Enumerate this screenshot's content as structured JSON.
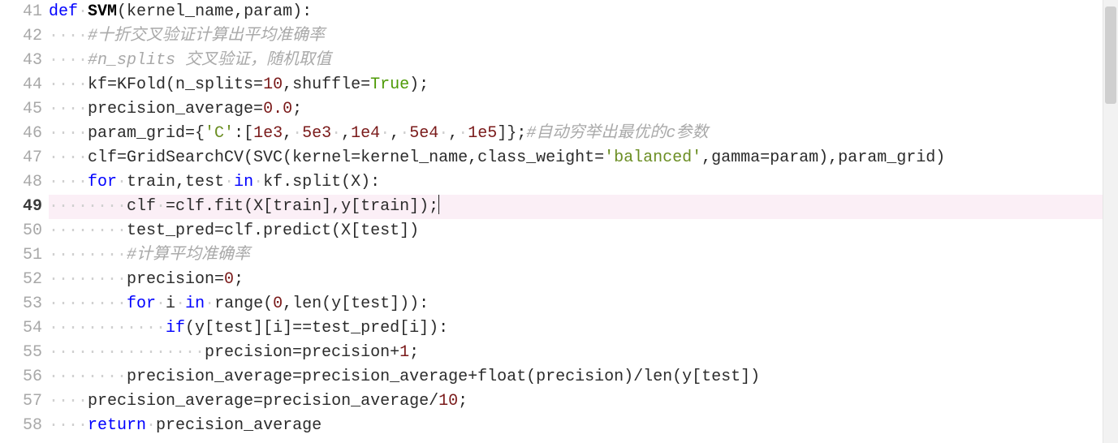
{
  "editor": {
    "currentLine": 49,
    "lines": [
      {
        "num": "41",
        "tokens": [
          {
            "cls": "kw",
            "t": "def"
          },
          {
            "cls": "ws",
            "t": "·"
          },
          {
            "cls": "fn",
            "t": "SVM"
          },
          {
            "cls": "tk",
            "t": "(kernel_name,param):"
          }
        ]
      },
      {
        "num": "42",
        "tokens": [
          {
            "cls": "ws",
            "t": "····"
          },
          {
            "cls": "cm",
            "t": "#十折交叉验证计算出平均准确率"
          }
        ]
      },
      {
        "num": "43",
        "tokens": [
          {
            "cls": "ws",
            "t": "····"
          },
          {
            "cls": "cm",
            "t": "#n_splits 交叉验证，随机取值"
          }
        ]
      },
      {
        "num": "44",
        "tokens": [
          {
            "cls": "ws",
            "t": "····"
          },
          {
            "cls": "tk",
            "t": "kf=KFold(n_splits="
          },
          {
            "cls": "num",
            "t": "10"
          },
          {
            "cls": "tk",
            "t": ",shuffle="
          },
          {
            "cls": "bool",
            "t": "True"
          },
          {
            "cls": "tk",
            "t": ");"
          }
        ]
      },
      {
        "num": "45",
        "tokens": [
          {
            "cls": "ws",
            "t": "····"
          },
          {
            "cls": "tk",
            "t": "precision_average="
          },
          {
            "cls": "num",
            "t": "0.0"
          },
          {
            "cls": "tk",
            "t": ";"
          }
        ]
      },
      {
        "num": "46",
        "tokens": [
          {
            "cls": "ws",
            "t": "····"
          },
          {
            "cls": "tk",
            "t": "param_grid={"
          },
          {
            "cls": "str",
            "t": "'C'"
          },
          {
            "cls": "tk",
            "t": ":["
          },
          {
            "cls": "num",
            "t": "1e3"
          },
          {
            "cls": "tk",
            "t": ","
          },
          {
            "cls": "ws",
            "t": "·"
          },
          {
            "cls": "num",
            "t": "5e3"
          },
          {
            "cls": "ws",
            "t": "·"
          },
          {
            "cls": "tk",
            "t": ","
          },
          {
            "cls": "num",
            "t": "1e4"
          },
          {
            "cls": "ws",
            "t": "·"
          },
          {
            "cls": "tk",
            "t": ","
          },
          {
            "cls": "ws",
            "t": "·"
          },
          {
            "cls": "num",
            "t": "5e4"
          },
          {
            "cls": "ws",
            "t": "·"
          },
          {
            "cls": "tk",
            "t": ","
          },
          {
            "cls": "ws",
            "t": "·"
          },
          {
            "cls": "num",
            "t": "1e5"
          },
          {
            "cls": "tk",
            "t": "]};"
          },
          {
            "cls": "cm",
            "t": "#自动穷举出最优的c参数"
          }
        ]
      },
      {
        "num": "47",
        "tokens": [
          {
            "cls": "ws",
            "t": "····"
          },
          {
            "cls": "tk",
            "t": "clf=GridSearchCV(SVC(kernel=kernel_name,class_weight="
          },
          {
            "cls": "str",
            "t": "'balanced'"
          },
          {
            "cls": "tk",
            "t": ",gamma=param),param_grid)"
          }
        ]
      },
      {
        "num": "48",
        "tokens": [
          {
            "cls": "ws",
            "t": "····"
          },
          {
            "cls": "kw",
            "t": "for"
          },
          {
            "cls": "ws",
            "t": "·"
          },
          {
            "cls": "tk",
            "t": "train,test"
          },
          {
            "cls": "ws",
            "t": "·"
          },
          {
            "cls": "kw",
            "t": "in"
          },
          {
            "cls": "ws",
            "t": "·"
          },
          {
            "cls": "tk",
            "t": "kf.split(X):"
          }
        ]
      },
      {
        "num": "49",
        "tokens": [
          {
            "cls": "ws",
            "t": "········"
          },
          {
            "cls": "tk",
            "t": "clf"
          },
          {
            "cls": "ws",
            "t": "·"
          },
          {
            "cls": "tk",
            "t": "=clf.fit(X[train],y[train]);"
          },
          {
            "cls": "cursor",
            "t": ""
          }
        ]
      },
      {
        "num": "50",
        "tokens": [
          {
            "cls": "ws",
            "t": "········"
          },
          {
            "cls": "tk",
            "t": "test_pred=clf.predict(X[test])"
          }
        ]
      },
      {
        "num": "51",
        "tokens": [
          {
            "cls": "ws",
            "t": "········"
          },
          {
            "cls": "cm",
            "t": "#计算平均准确率"
          }
        ]
      },
      {
        "num": "52",
        "tokens": [
          {
            "cls": "ws",
            "t": "········"
          },
          {
            "cls": "tk",
            "t": "precision="
          },
          {
            "cls": "num",
            "t": "0"
          },
          {
            "cls": "tk",
            "t": ";"
          }
        ]
      },
      {
        "num": "53",
        "tokens": [
          {
            "cls": "ws",
            "t": "········"
          },
          {
            "cls": "kw",
            "t": "for"
          },
          {
            "cls": "ws",
            "t": "·"
          },
          {
            "cls": "tk",
            "t": "i"
          },
          {
            "cls": "ws",
            "t": "·"
          },
          {
            "cls": "kw",
            "t": "in"
          },
          {
            "cls": "ws",
            "t": "·"
          },
          {
            "cls": "tk",
            "t": "range("
          },
          {
            "cls": "num",
            "t": "0"
          },
          {
            "cls": "tk",
            "t": ",len(y[test])):"
          }
        ]
      },
      {
        "num": "54",
        "tokens": [
          {
            "cls": "ws",
            "t": "············"
          },
          {
            "cls": "kw",
            "t": "if"
          },
          {
            "cls": "tk",
            "t": "(y[test][i]==test_pred[i]):"
          }
        ]
      },
      {
        "num": "55",
        "tokens": [
          {
            "cls": "ws",
            "t": "················"
          },
          {
            "cls": "tk",
            "t": "precision=precision+"
          },
          {
            "cls": "num",
            "t": "1"
          },
          {
            "cls": "tk",
            "t": ";"
          }
        ]
      },
      {
        "num": "56",
        "tokens": [
          {
            "cls": "ws",
            "t": "········"
          },
          {
            "cls": "tk",
            "t": "precision_average=precision_average+float(precision)/len(y[test])"
          }
        ]
      },
      {
        "num": "57",
        "tokens": [
          {
            "cls": "ws",
            "t": "····"
          },
          {
            "cls": "tk",
            "t": "precision_average=precision_average/"
          },
          {
            "cls": "num",
            "t": "10"
          },
          {
            "cls": "tk",
            "t": ";"
          }
        ]
      },
      {
        "num": "58",
        "tokens": [
          {
            "cls": "ws",
            "t": "····"
          },
          {
            "cls": "kw",
            "t": "return"
          },
          {
            "cls": "ws",
            "t": "·"
          },
          {
            "cls": "tk",
            "t": "precision_average"
          }
        ]
      }
    ]
  }
}
